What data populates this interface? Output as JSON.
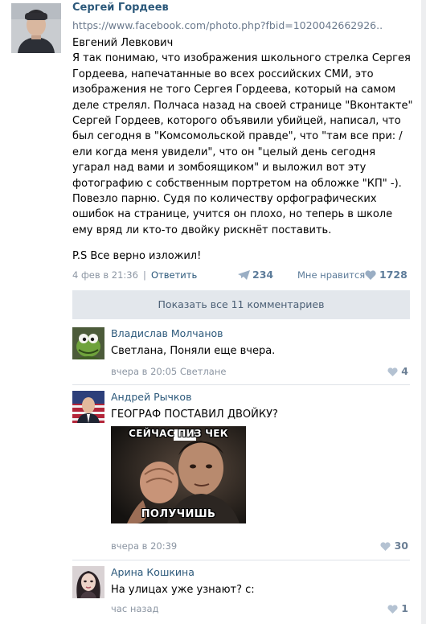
{
  "post": {
    "author": "Сергей Гордеев",
    "link": "https://www.facebook.com/photo.php?fbid=1020042662926..",
    "paragraph": "Евгений Левкович\nЯ так понимаю, что изображения школьного стрелка Сергея Гордеева, напечатанные во всех российских СМИ, это изображения не того Сергея Гордеева, который на самом деле стрелял. Полчаса назад на своей странице \"Вконтакте\" Сергей Гордеев, которого объявили убийцей, написал, что был сегодня в \"Комсомольской правде\", что \"там все при: /ели когда меня увидели\", что он \"целый день сегодня угарал над вами и зомбоящиком\" и выложил вот эту фотографию с собственным портретом на обложке \"КП\" -). Повезло парню. Судя по количеству орфографических ошибок на странице, учится он плохо, но теперь в школе ему вряд ли кто-то двойку рискнёт поставить.",
    "ps": "P.S Все верно изложил!",
    "date": "4 фев в 21:36",
    "reply": "Ответить",
    "shares": "234",
    "like_label": "Мне нравится",
    "likes": "1728"
  },
  "show_all_comments": "Показать все 11 комментариев",
  "comments": [
    {
      "name": "Владислав Молчанов",
      "text": "Светлана, Поняли еще вчера.",
      "meta": "вчера в 20:05 Светлане",
      "likes": "4"
    },
    {
      "name": "Андрей Рычков",
      "text": "ГЕОГРАФ ПОСТАВИЛ ДВОЙКУ?",
      "image_top": "СЕЙЧАС ПИЗ   ЧЕК",
      "image_bottom": "ПОЛУЧИШЬ",
      "meta": "вчера в 20:39",
      "likes": "30"
    },
    {
      "name": "Арина Кошкина",
      "text": "На улицах уже узнают? с:",
      "meta": "час назад",
      "likes": "1"
    }
  ],
  "colors": {
    "link": "#2b587a",
    "meta": "#8c96a3",
    "show_all_bg": "#e3e7ec"
  }
}
